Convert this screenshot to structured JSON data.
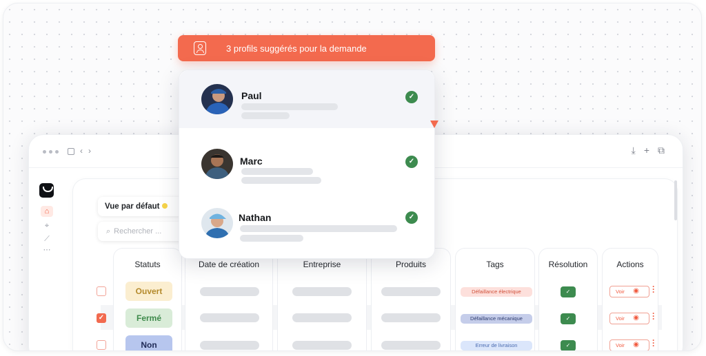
{
  "banner": {
    "text": "3 profils suggérés pour la demande",
    "icon": "contact-card-icon"
  },
  "profiles": [
    {
      "name": "Paul",
      "verified": true
    },
    {
      "name": "Marc",
      "verified": true
    },
    {
      "name": "Nathan",
      "verified": true
    }
  ],
  "toolbar": {
    "view_label": "Vue par défaut",
    "search_placeholder": "Rechercher ..."
  },
  "table": {
    "columns": [
      "Statuts",
      "Date de création",
      "Entreprise",
      "Produits",
      "Tags",
      "Résolution",
      "Actions"
    ],
    "rows": [
      {
        "checked": false,
        "status": "Ouvert",
        "tag": "Défaillance électrique",
        "action": "Voir"
      },
      {
        "checked": true,
        "status": "Fermé",
        "tag": "Défaillance mécanique",
        "action": "Voir"
      },
      {
        "checked": false,
        "status": "Non assigné",
        "tag": "Erreur de livraison",
        "action": "Voir"
      }
    ]
  },
  "colors": {
    "accent": "#f36a4e",
    "verified": "#3d8b4f",
    "status_ouvert_bg": "#fbeed0",
    "status_ferme_bg": "#d9ecd8",
    "status_non_assigne_bg": "#b7c6ee"
  }
}
